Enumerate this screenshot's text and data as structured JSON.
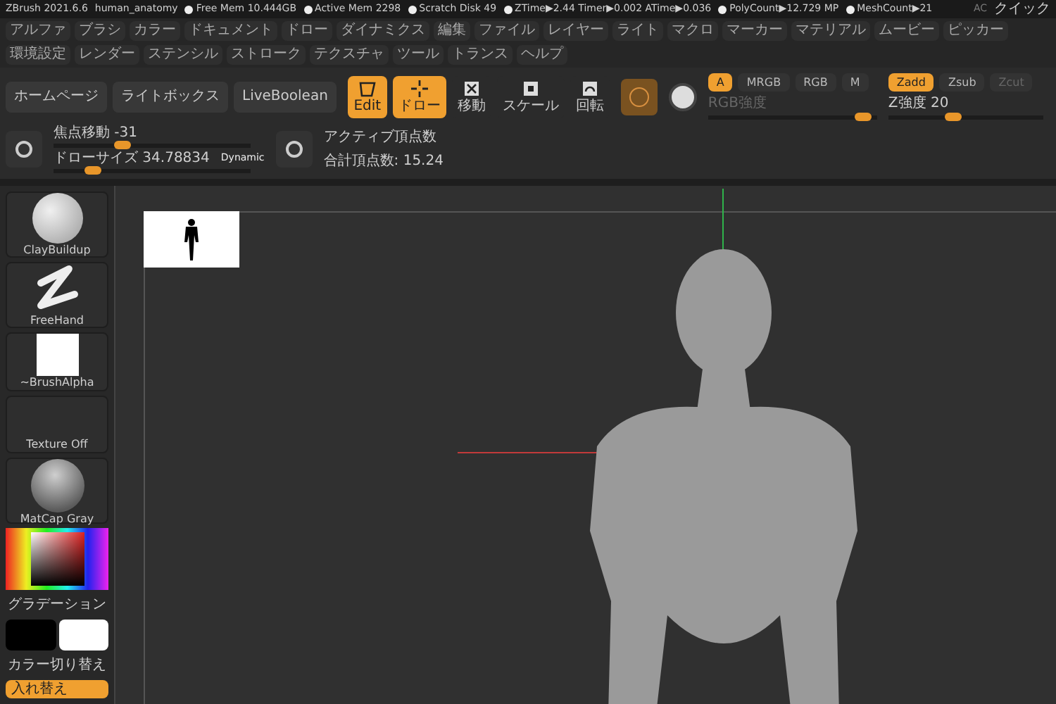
{
  "title_bar": {
    "app": "ZBrush 2021.6.6",
    "file": "human_anatomy",
    "stats": [
      "Free Mem 10.444GB",
      "Active Mem 2298",
      "Scratch Disk 49",
      "ZTime▶2.44 Timer▶0.002 ATime▶0.036",
      "PolyCount▶12.729 MP",
      "MeshCount▶21"
    ],
    "right": [
      "AC",
      "クイック"
    ]
  },
  "menu": [
    "アルファ",
    "ブラシ",
    "カラー",
    "ドキュメント",
    "ドロー",
    "ダイナミクス",
    "編集",
    "ファイル",
    "レイヤー",
    "ライト",
    "マクロ",
    "マーカー",
    "マテリアル",
    "ムービー",
    "ピッカー",
    "環境設定",
    "レンダー",
    "ステンシル",
    "ストローク",
    "テクスチャ",
    "ツール",
    "トランス",
    "ヘルプ"
  ],
  "toolbar": {
    "nav_buttons": [
      "ホームページ",
      "ライトボックス",
      "LiveBoolean"
    ],
    "tools": [
      {
        "kind": "edit",
        "label": "Edit",
        "selected": true
      },
      {
        "kind": "draw",
        "label": "ドロー",
        "selected": true
      },
      {
        "kind": "move",
        "label": "移動",
        "selected": false
      },
      {
        "kind": "scale",
        "label": "スケール",
        "selected": false
      },
      {
        "kind": "rotate",
        "label": "回転",
        "selected": false
      }
    ],
    "channels": [
      {
        "label": "A",
        "selected": true
      },
      {
        "label": "MRGB",
        "selected": false
      },
      {
        "label": "RGB",
        "selected": false
      },
      {
        "label": "M",
        "selected": false
      }
    ],
    "rgb_slider": {
      "label": "RGB強度",
      "level": 0.92,
      "disabled": true
    },
    "z_modes": [
      {
        "label": "Zadd",
        "selected": true,
        "disabled": false
      },
      {
        "label": "Zsub",
        "selected": false,
        "disabled": false
      },
      {
        "label": "Zcut",
        "selected": false,
        "disabled": true
      }
    ],
    "z_slider": {
      "label": "Z強度 20",
      "level": 0.42
    },
    "focal_slider": {
      "label": "焦点移動 -31",
      "level": 0.35
    },
    "size_slider": {
      "label": "ドローサイズ 34.78834",
      "level": 0.2
    },
    "dynamic": "Dynamic",
    "active_points": "アクティブ頂点数",
    "total_points": "合計頂点数: 15.24"
  },
  "sidebar": {
    "tiles": [
      {
        "kind": "sphere",
        "label": "ClayBuildup"
      },
      {
        "kind": "stroke",
        "label": "FreeHand"
      },
      {
        "kind": "alpha",
        "label": "~BrushAlpha"
      },
      {
        "kind": "empty",
        "label": "Texture Off"
      },
      {
        "kind": "matcap",
        "label": "MatCap Gray"
      }
    ],
    "gradient_label": "グラデーション",
    "swatches": [
      {
        "color": "#000000"
      },
      {
        "color": "#ffffff"
      }
    ],
    "switch_label": "カラー切り替え",
    "swap_button": "入れ替え"
  }
}
